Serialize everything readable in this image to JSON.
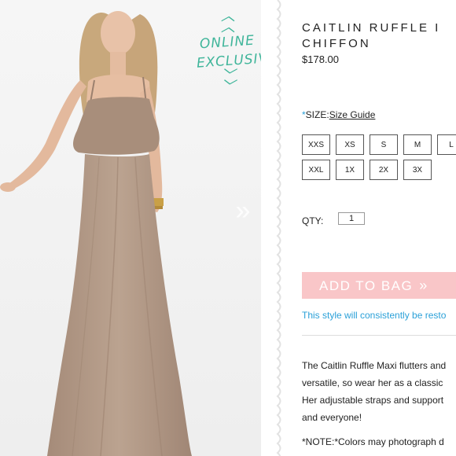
{
  "badge": {
    "line1": "ONLINE",
    "line2": "EXCLUSIVE",
    "color": "#3fb59a"
  },
  "carousel": {
    "next_icon": "double-chevron-right-icon",
    "next_glyph": "»"
  },
  "product": {
    "title_line1": "CAITLIN RUFFLE I",
    "title_line2": "CHIFFON",
    "price": "$178.00"
  },
  "size": {
    "star": "*",
    "label": "SIZE:",
    "guide_link": "Size Guide",
    "options_row1": [
      "XXS",
      "XS",
      "S",
      "M",
      "L"
    ],
    "options_row2": [
      "XXL",
      "1X",
      "2X",
      "3X"
    ]
  },
  "quantity": {
    "label": "QTY:",
    "value": "1"
  },
  "cart": {
    "add_label": "ADD TO BAG",
    "add_arrows": "»",
    "button_color": "#f9c6c8"
  },
  "restock_note": "This style will consistently be resto",
  "description_lines": [
    "The Caitlin Ruffle Maxi flutters and",
    "versatile, so wear her as a classic",
    "Her adjustable straps and support",
    "and everyone!"
  ],
  "color_note": "*NOTE:*Colors may photograph d",
  "colors": {
    "accent_blue": "#2aa0d8",
    "dress_taupe": "#b09684"
  }
}
